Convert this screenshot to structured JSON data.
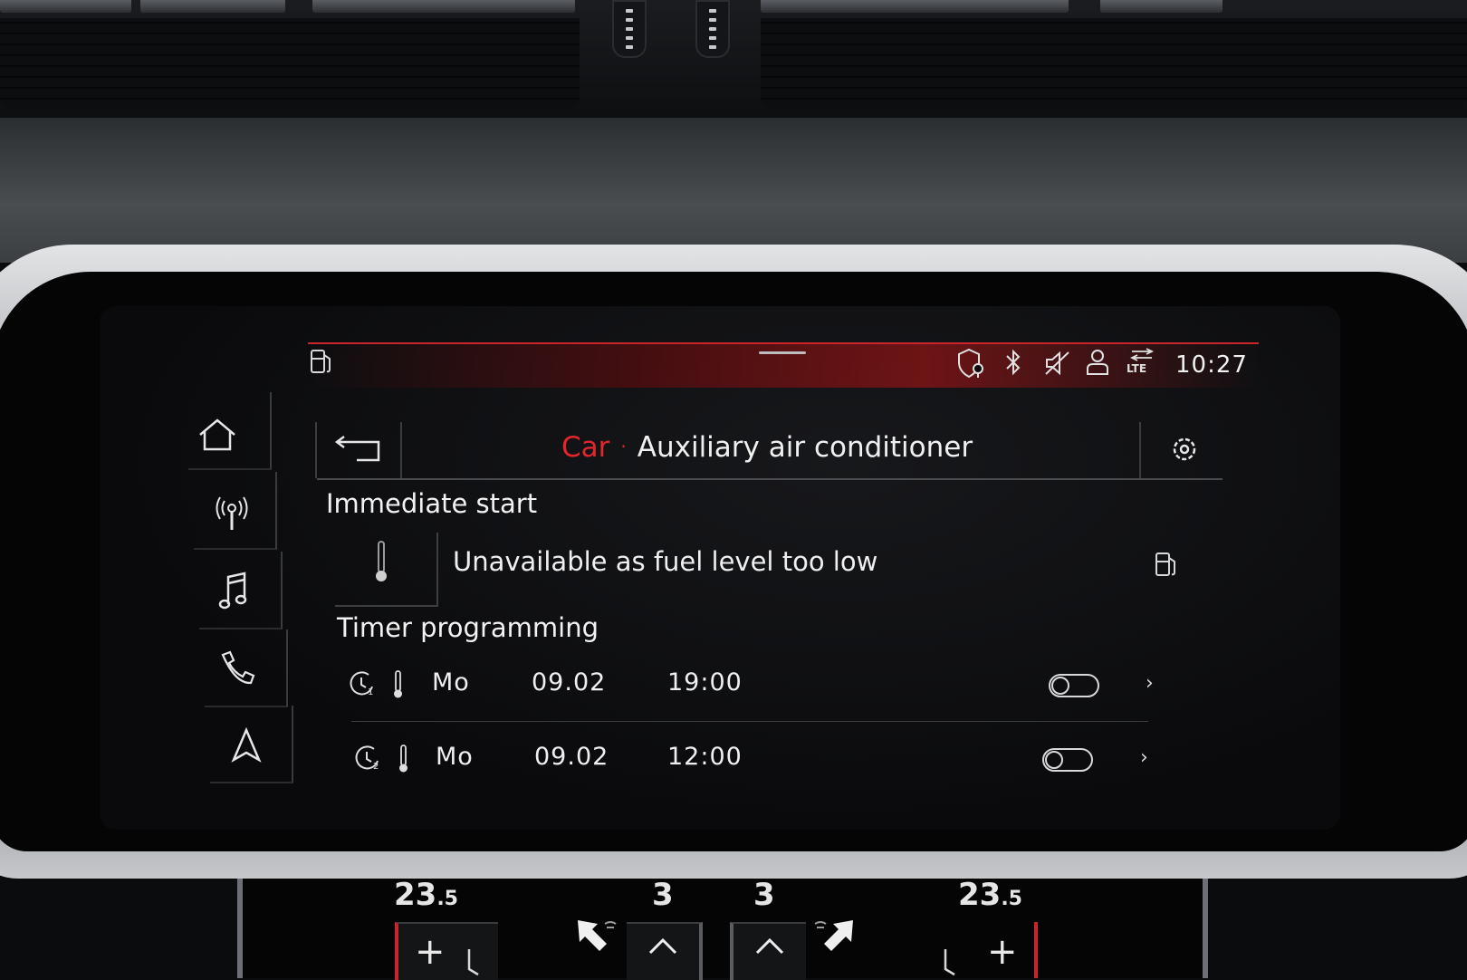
{
  "status_bar": {
    "time": "10:27",
    "icons": [
      "fuel-icon",
      "location-shield-icon",
      "bluetooth-icon",
      "mute-icon",
      "user-icon",
      "lte-icon"
    ],
    "lte_label": "LTE"
  },
  "sidebar": {
    "items": [
      {
        "icon": "home-icon"
      },
      {
        "icon": "radio-icon"
      },
      {
        "icon": "music-icon"
      },
      {
        "icon": "phone-icon"
      },
      {
        "icon": "navigation-icon"
      }
    ]
  },
  "header": {
    "breadcrumb_parent": "Car",
    "separator": "·",
    "title": "Auxiliary air conditioner"
  },
  "immediate_start": {
    "heading": "Immediate start",
    "message": "Unavailable as fuel level too low"
  },
  "timer_programming": {
    "heading": "Timer programming",
    "timers": [
      {
        "index": "1",
        "day": "Mo",
        "date": "09.02",
        "time": "19:00",
        "enabled": false
      },
      {
        "index": "2",
        "day": "Mo",
        "date": "09.02",
        "time": "12:00",
        "enabled": false
      }
    ]
  },
  "climate_panel": {
    "left_temp": "23",
    "left_temp_decimal": ".5",
    "left_fan": "3",
    "right_fan": "3",
    "right_temp": "23",
    "right_temp_decimal": ".5",
    "plus_label": "+"
  },
  "colors": {
    "accent_red": "#e3262b",
    "text": "#efefef",
    "background": "#0a0a0c"
  }
}
